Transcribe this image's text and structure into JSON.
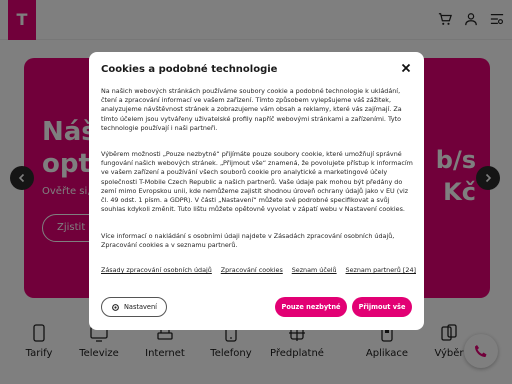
{
  "header": {
    "logo_text": "T",
    "icons": [
      "cart-icon",
      "user-icon",
      "menu-icon"
    ]
  },
  "hero": {
    "title_line1": "Náš",
    "title_line2": "opti",
    "subtitle": "Ověřte si, j",
    "button_label": "Zjistit n",
    "right_line1": "b/s",
    "right_line2": "Kč"
  },
  "categories": [
    {
      "label": "Tarify",
      "icon": "phone-icon"
    },
    {
      "label": "Televize",
      "icon": "tv-icon"
    },
    {
      "label": "Internet",
      "icon": "router-icon"
    },
    {
      "label": "Telefony",
      "icon": "smartphone-icon"
    },
    {
      "label": "Předplatné",
      "icon": "subscription-icon"
    },
    {
      "label": "Aplikace",
      "icon": "apps-icon"
    },
    {
      "label": "Výběr",
      "icon": "devices-icon"
    }
  ],
  "modal": {
    "title": "Cookies a podobné technologie",
    "paragraph1": "Na našich webových stránkách používáme soubory cookie a podobné technologie k ukládání, čtení a zpracování informací ve vašem zařízení. Tímto způsobem vylepšujeme váš zážitek, analyzujeme návštěvnost stránek a zobrazujeme vám obsah a reklamy, které vás zajímají. Za tímto účelem jsou vytvářeny uživatelské profily napříč webovými stránkami a zařízeními. Tyto technologie používají i naši partneři.",
    "paragraph2": "Výběrem možnosti „Pouze nezbytné“ přijímáte pouze soubory cookie, které umožňují správné fungování našich webových stránek. „Přijmout vše“ znamená, že povolujete přístup k informacím ve vašem zařízení a používání všech souborů cookie pro analytické a marketingové účely společnosti T-Mobile Czech Republic a našich partnerů. Vaše údaje pak mohou být předány do zemí mimo Evropskou unii, kde nemůžeme zajistit shodnou úroveň ochrany údajů jako v EU (viz čl. 49 odst. 1 písm. a GDPR). V části „Nastavení“ můžete své podrobné specifikovat a svůj souhlas kdykoli změnit. Tuto lištu můžete opětovně vyvolat v zápatí webu v Nastavení cookies.",
    "paragraph3": "Více informací o nakládání s osobními údaji najdete v Zásadách zpracování osobních údajů, Zpracování cookies a v seznamu partnerů.",
    "links": [
      "Zásady zpracování osobních údajů",
      "Zpracování cookies",
      "Seznam účelů",
      "Seznam partnerů [24]"
    ],
    "settings_label": "Nastavení",
    "necessary_label": "Pouze nezbytné",
    "accept_label": "Přijmout vše"
  },
  "colors": {
    "brand": "#e20074",
    "overlay": "rgba(0,0,0,0.5)"
  }
}
